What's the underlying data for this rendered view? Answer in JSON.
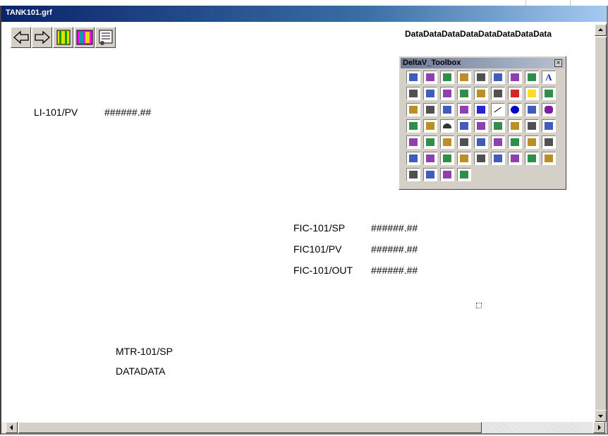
{
  "window": {
    "title": "TANK101.grf"
  },
  "header": {
    "data_string": "DataDataDataDataDataDataDataData"
  },
  "toolbar": {
    "buttons": [
      "back-arrow-icon",
      "forward-arrow-icon",
      "bars-icon",
      "faceplate-icon",
      "detail-icon"
    ]
  },
  "labels": {
    "li_tag": "LI-101/PV",
    "li_value": "######.##",
    "fic_sp_tag": "FIC-101/SP",
    "fic_sp_value": "######.##",
    "fic_pv_tag": "FIC101/PV",
    "fic_pv_value": "######.##",
    "fic_out_tag": "FIC-101/OUT",
    "fic_out_value": "######.##",
    "mtr_tag": "MTR-101/SP",
    "mtr_value": "DATADATA"
  },
  "toolbox": {
    "title": "DeltaV_Toolbox",
    "close": "×",
    "tools": [
      [
        "new",
        "open",
        "open-folder",
        "save",
        "undo",
        "bracket",
        "preview",
        "disk",
        "text-A"
      ],
      [
        "wand",
        "fxf",
        "abc",
        "pen",
        "m0",
        "tiles",
        "chart",
        "bell",
        "gear"
      ],
      [
        "clock",
        "panel",
        "dots",
        "bars",
        "rect",
        "line",
        "ellipse",
        "arc",
        "rounded-rect"
      ],
      [
        "polygon",
        "pipe",
        "half-circle",
        "triangle",
        "layer1",
        "layer2",
        "layer3",
        "layer4",
        "layer5"
      ],
      [
        "align1",
        "align2",
        "align3",
        "align4",
        "align5",
        "align6",
        "align7",
        "align8",
        "align9"
      ],
      [
        "box",
        "box-shadow",
        "dot",
        "bucket",
        "link",
        "rotate",
        "slash",
        "zoom",
        "bar"
      ],
      [
        "line-color",
        "monitor1",
        "monitor2",
        "monitor3"
      ]
    ],
    "colors": {
      "rect": "#0000cc",
      "ellipse": "#0000cc",
      "bell": "#ffd400",
      "chart": "#cc0000"
    }
  }
}
